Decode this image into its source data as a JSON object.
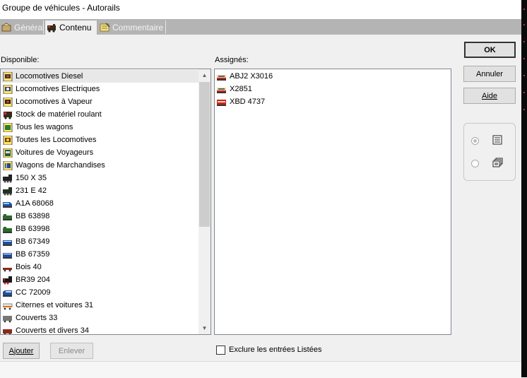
{
  "window": {
    "title": "Groupe de véhicules - Autorails"
  },
  "tabs": [
    {
      "label": "Général",
      "icon": "settings-tab-icon",
      "active": false
    },
    {
      "label": "Contenu",
      "icon": "locomotive-tab-icon",
      "active": true
    },
    {
      "label": "Commentaire",
      "icon": "notepad-tab-icon",
      "active": false
    }
  ],
  "available": {
    "label": "Disponible:",
    "items": [
      {
        "label": "Locomotives Diesel",
        "icon": "filter-diesel-icon",
        "selected": true
      },
      {
        "label": "Locomotives Electriques",
        "icon": "filter-electric-icon"
      },
      {
        "label": "Locomotives à Vapeur",
        "icon": "filter-steam-icon"
      },
      {
        "label": "Stock de matériel roulant",
        "icon": "stock-icon"
      },
      {
        "label": "Tous les wagons",
        "icon": "filter-wagons-icon"
      },
      {
        "label": "Toutes les Locomotives",
        "icon": "filter-locomotives-icon"
      },
      {
        "label": "Voitures de Voyageurs",
        "icon": "filter-coaches-icon"
      },
      {
        "label": "Wagons de Marchandises",
        "icon": "filter-freight-icon"
      },
      {
        "label": "150 X 35",
        "icon": "steam-locomotive-icon"
      },
      {
        "label": "231 E 42",
        "icon": "steam-locomotive-icon"
      },
      {
        "label": "A1A 68068",
        "icon": "diesel-locomotive-icon"
      },
      {
        "label": "BB 63898",
        "icon": "diesel-locomotive-icon"
      },
      {
        "label": "BB 63998",
        "icon": "diesel-locomotive-icon"
      },
      {
        "label": "BB 67349",
        "icon": "diesel-locomotive-icon"
      },
      {
        "label": "BB 67359",
        "icon": "diesel-locomotive-icon"
      },
      {
        "label": "Bois 40",
        "icon": "wagon-icon"
      },
      {
        "label": "BR39 204",
        "icon": "steam-locomotive-icon"
      },
      {
        "label": "CC 72009",
        "icon": "diesel-locomotive-icon"
      },
      {
        "label": "Citernes et voitures 31",
        "icon": "wagon-icon"
      },
      {
        "label": "Couverts 33",
        "icon": "wagon-icon"
      },
      {
        "label": "Couverts et divers 34",
        "icon": "wagon-icon"
      }
    ]
  },
  "assigned": {
    "label": "Assignés:",
    "items": [
      {
        "label": "ABJ2 X3016",
        "icon": "railcar-icon"
      },
      {
        "label": "X2851",
        "icon": "railcar-icon"
      },
      {
        "label": "XBD 4737",
        "icon": "railcar-icon"
      }
    ]
  },
  "buttons": {
    "ok": "OK",
    "cancel": "Annuler",
    "help": "Aide",
    "add": "Ajouter",
    "remove": "Enlever"
  },
  "view_options": {
    "selected": "list"
  },
  "exclude_listed": {
    "label": "Exclure les entrées Listées",
    "checked": false
  },
  "colors": {
    "tab_bar": "#b4b4b4",
    "panel": "#f0f0f0",
    "selection": "#e8e8e8"
  }
}
